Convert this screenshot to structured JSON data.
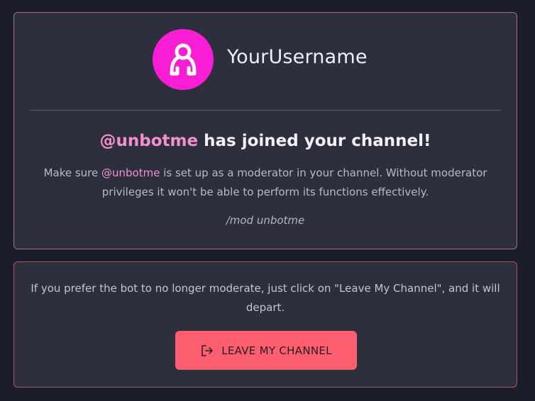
{
  "profile": {
    "username": "YourUsername",
    "avatar_icon": "user-icon",
    "avatar_color": "#f71ed4"
  },
  "joined": {
    "bot_mention": "@unbotme",
    "headline_rest": " has joined your channel!",
    "desc_prefix": "Make sure ",
    "desc_mention": "@unbotme",
    "desc_suffix": " is set up as a moderator in your channel. Without moderator privileges it won't be able to perform its functions effectively.",
    "command": "/mod unbotme"
  },
  "leave": {
    "text": "If you prefer the bot to no longer moderate, just click on \"Leave My Channel\", and it will depart.",
    "button_label": "LEAVE MY CHANNEL",
    "button_icon": "sign-out-icon",
    "button_color": "#fd5f70"
  },
  "colors": {
    "accent_pink": "#f291cf",
    "background": "#1b1d28",
    "card": "#2d2f3d"
  }
}
